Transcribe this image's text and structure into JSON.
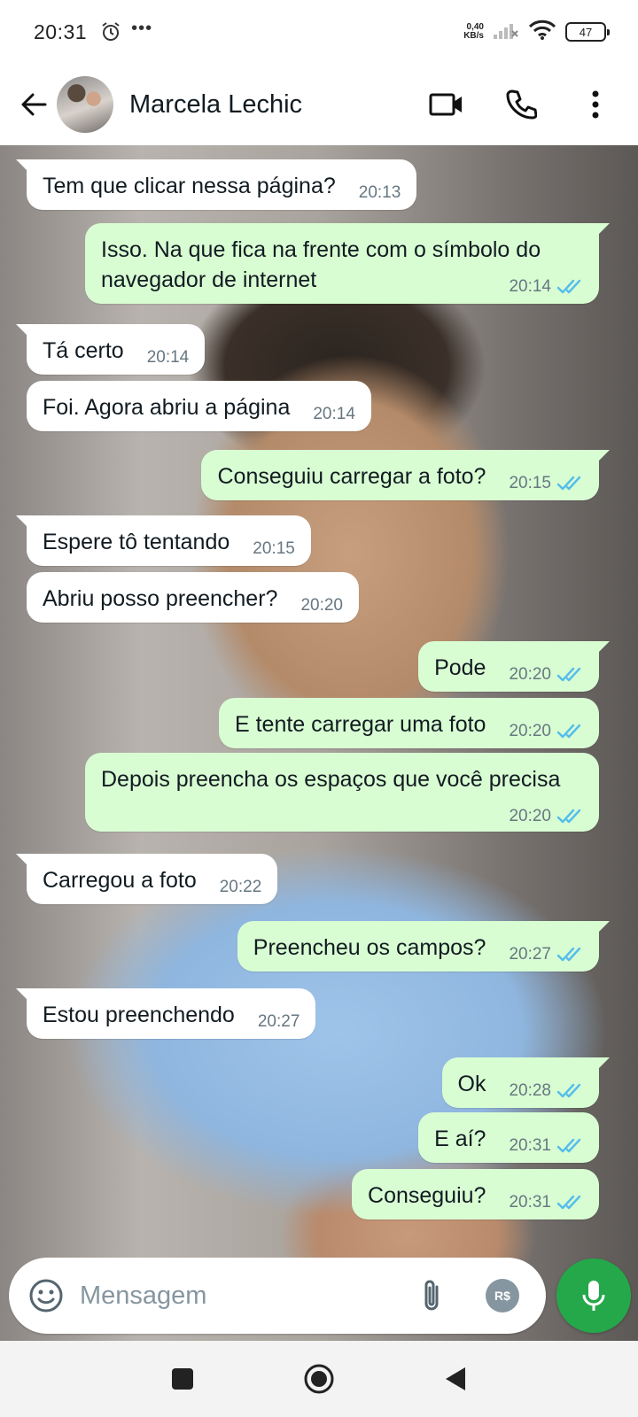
{
  "status_bar": {
    "time": "20:31",
    "net_speed_value": "0,40",
    "net_speed_unit": "KB/s",
    "battery": "47"
  },
  "header": {
    "contact_name": "Marcela Lechic"
  },
  "messages": [
    {
      "dir": "in",
      "first": true,
      "text": "Tem que clicar nessa página?",
      "time": "20:13"
    },
    {
      "dir": "out",
      "first": true,
      "text": "Isso. Na que fica na frente com o símbolo do navegador de internet",
      "time": "20:14",
      "read": true
    },
    {
      "dir": "in",
      "first": true,
      "text": "Tá certo",
      "time": "20:14"
    },
    {
      "dir": "in",
      "first": false,
      "text": "Foi. Agora abriu a página",
      "time": "20:14"
    },
    {
      "dir": "out",
      "first": true,
      "text": "Conseguiu carregar a foto?",
      "time": "20:15",
      "read": true
    },
    {
      "dir": "in",
      "first": true,
      "text": "Espere tô tentando",
      "time": "20:15"
    },
    {
      "dir": "in",
      "first": false,
      "text": "Abriu posso preencher?",
      "time": "20:20"
    },
    {
      "dir": "out",
      "first": true,
      "text": "Pode",
      "time": "20:20",
      "read": true
    },
    {
      "dir": "out",
      "first": false,
      "text": "E tente carregar uma foto",
      "time": "20:20",
      "read": true
    },
    {
      "dir": "out",
      "first": false,
      "text": "Depois preencha os espaços que você precisa",
      "time": "20:20",
      "read": true
    },
    {
      "dir": "in",
      "first": true,
      "text": "Carregou a foto",
      "time": "20:22"
    },
    {
      "dir": "out",
      "first": true,
      "text": "Preencheu os campos?",
      "time": "20:27",
      "read": true
    },
    {
      "dir": "in",
      "first": true,
      "text": "Estou preenchendo",
      "time": "20:27"
    },
    {
      "dir": "out",
      "first": true,
      "text": "Ok",
      "time": "20:28",
      "read": true
    },
    {
      "dir": "out",
      "first": false,
      "text": "E aí?",
      "time": "20:31",
      "read": true
    },
    {
      "dir": "out",
      "first": false,
      "text": "Conseguiu?",
      "time": "20:31",
      "read": true
    }
  ],
  "input": {
    "placeholder": "Mensagem",
    "pay_label": "R$"
  },
  "icons": {
    "back": "arrow-left-icon",
    "video": "video-camera-icon",
    "call": "phone-icon",
    "menu": "more-vertical-icon",
    "emoji": "emoji-icon",
    "attach": "paperclip-icon",
    "camera": "camera-icon",
    "mic": "microphone-icon"
  },
  "colors": {
    "outgoing_bubble": "#d9fdd3",
    "incoming_bubble": "#ffffff",
    "read_ticks": "#53bdeb",
    "mic_button": "#25a84a"
  }
}
